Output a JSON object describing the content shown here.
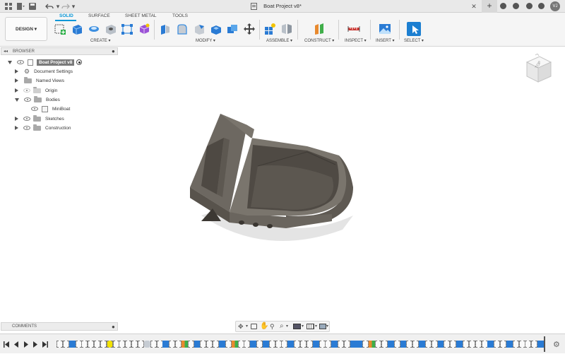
{
  "window": {
    "title": "Boat Project v8*"
  },
  "titlebar": {
    "avatar": "VJ"
  },
  "toolbar": {
    "workspace": "DESIGN ▾",
    "tabs": [
      "SOLID",
      "SURFACE",
      "SHEET METAL",
      "TOOLS"
    ],
    "active_tab": "SOLID",
    "groups": [
      "CREATE ▾",
      "MODIFY ▾",
      "ASSEMBLE ▾",
      "CONSTRUCT ▾",
      "INSPECT ▾",
      "INSERT ▾",
      "SELECT ▾"
    ]
  },
  "browser": {
    "title": "BROWSER",
    "root": "Boat Project v8",
    "items": [
      "Document Settings",
      "Named Views",
      "Origin",
      "Bodies",
      "MiniBoat",
      "Sketches",
      "Construction"
    ]
  },
  "viewcube": {
    "face": "TOP"
  },
  "comments": {
    "title": "COMMENTS"
  },
  "colors": {
    "accent": "#0696d7",
    "model_body": "#6e6860",
    "highlight": "#f2e200"
  }
}
